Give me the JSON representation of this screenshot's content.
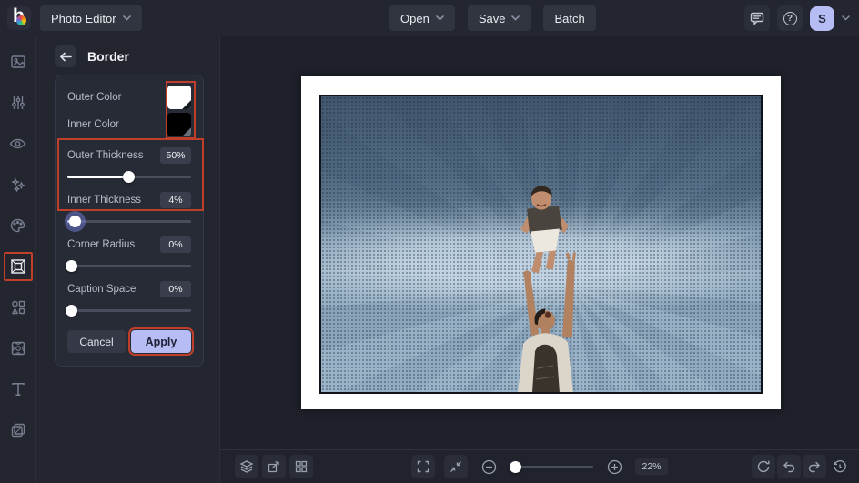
{
  "topbar": {
    "logo_letter": "b",
    "app_menu_label": "Photo Editor",
    "open_label": "Open",
    "save_label": "Save",
    "batch_label": "Batch",
    "help_glyph": "?",
    "avatar_initial": "S"
  },
  "sidebar": {
    "icons": [
      "image",
      "adjustments",
      "touch-up-eye",
      "effects-sparkles",
      "artsy-palette",
      "frames-border",
      "graphics-shapes",
      "overlays-pattern",
      "text",
      "layers"
    ],
    "active_icon": "frames-border"
  },
  "panel": {
    "title": "Border",
    "colors": [
      {
        "label": "Outer Color",
        "value": "#ffffff"
      },
      {
        "label": "Inner Color",
        "value": "#000000"
      }
    ],
    "sliders": [
      {
        "label": "Outer Thickness",
        "value": "50%"
      },
      {
        "label": "Inner Thickness",
        "value": "4%"
      },
      {
        "label": "Corner Radius",
        "value": "0%"
      },
      {
        "label": "Caption Space",
        "value": "0%"
      }
    ],
    "cancel_label": "Cancel",
    "apply_label": "Apply"
  },
  "bottombar": {
    "zoom_value": "22%"
  },
  "colors": {
    "annotation_red": "#bf3f2b",
    "accent_periwinkle": "#b7bcf4",
    "canvas_white": "#ffffff",
    "inner_border_black": "#10131a"
  }
}
